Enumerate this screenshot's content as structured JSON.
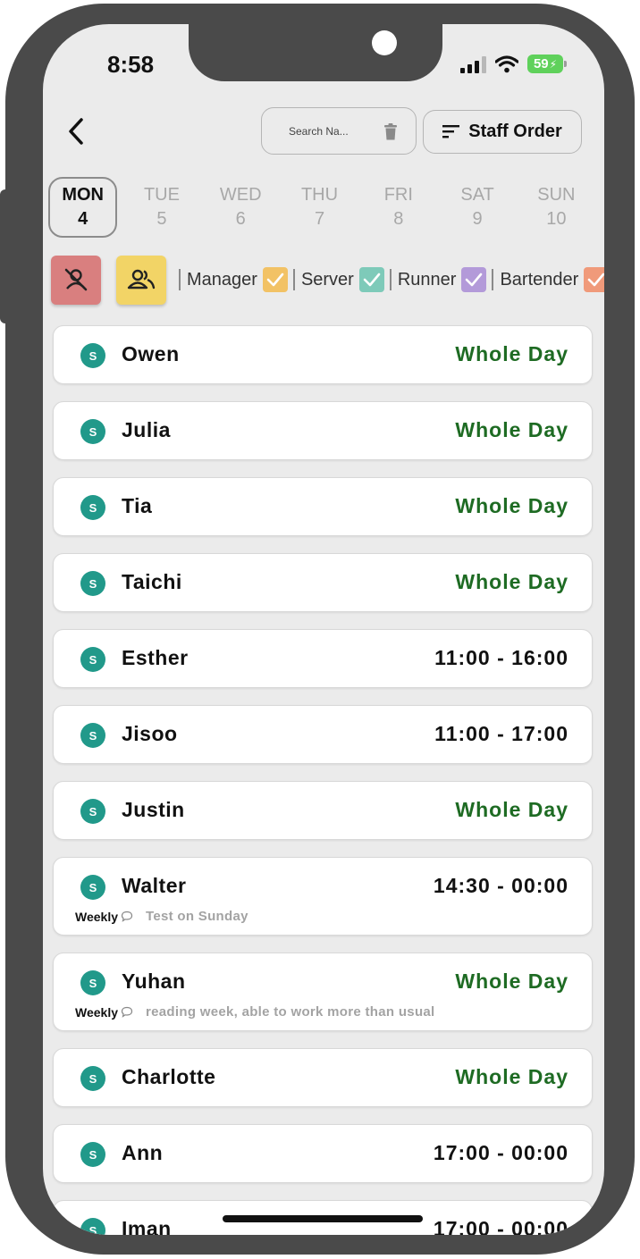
{
  "status_bar": {
    "time": "8:58",
    "battery": "59"
  },
  "header": {
    "search_placeholder": "Search Na...",
    "staff_order_label": "Staff Order"
  },
  "days": [
    {
      "name": "MON",
      "num": "4"
    },
    {
      "name": "TUE",
      "num": "5"
    },
    {
      "name": "WED",
      "num": "6"
    },
    {
      "name": "THU",
      "num": "7"
    },
    {
      "name": "FRI",
      "num": "8"
    },
    {
      "name": "SAT",
      "num": "9"
    },
    {
      "name": "SUN",
      "num": "10"
    }
  ],
  "selected_day": "MON",
  "roles": [
    {
      "label": "Manager",
      "color": "#f2c265"
    },
    {
      "label": "Server",
      "color": "#7ecab9"
    },
    {
      "label": "Runner",
      "color": "#b39ad9"
    },
    {
      "label": "Bartender",
      "color": "#f09a7a"
    }
  ],
  "filter_colors": {
    "unavailable": "#d97f7f",
    "available": "#f2d466"
  },
  "staff": [
    {
      "badge": "S",
      "name": "Owen",
      "time": "Whole Day"
    },
    {
      "badge": "S",
      "name": "Julia",
      "time": "Whole Day"
    },
    {
      "badge": "S",
      "name": "Tia",
      "time": "Whole Day"
    },
    {
      "badge": "S",
      "name": "Taichi",
      "time": "Whole Day"
    },
    {
      "badge": "S",
      "name": "Esther",
      "time": "11:00 - 16:00"
    },
    {
      "badge": "S",
      "name": "Jisoo",
      "time": "11:00 - 17:00"
    },
    {
      "badge": "S",
      "name": "Justin",
      "time": "Whole Day"
    },
    {
      "badge": "S",
      "name": "Walter",
      "time": "14:30 - 00:00",
      "frequency": "Weekly",
      "comment": "Test on Sunday"
    },
    {
      "badge": "S",
      "name": "Yuhan",
      "time": "Whole Day",
      "frequency": "Weekly",
      "comment": "reading week, able to work more than usual"
    },
    {
      "badge": "S",
      "name": "Charlotte",
      "time": "Whole Day"
    },
    {
      "badge": "S",
      "name": "Ann",
      "time": "17:00 - 00:00"
    },
    {
      "badge": "S",
      "name": "Iman",
      "time": "17:00 - 00:00"
    }
  ],
  "colors": {
    "badge": "#21998a",
    "whole_day": "#1e6b23"
  },
  "icons": [
    "back-icon",
    "trash-icon",
    "sort-icon",
    "user-off-icon",
    "users-icon",
    "check-icon",
    "comment-bubble-icon"
  ]
}
